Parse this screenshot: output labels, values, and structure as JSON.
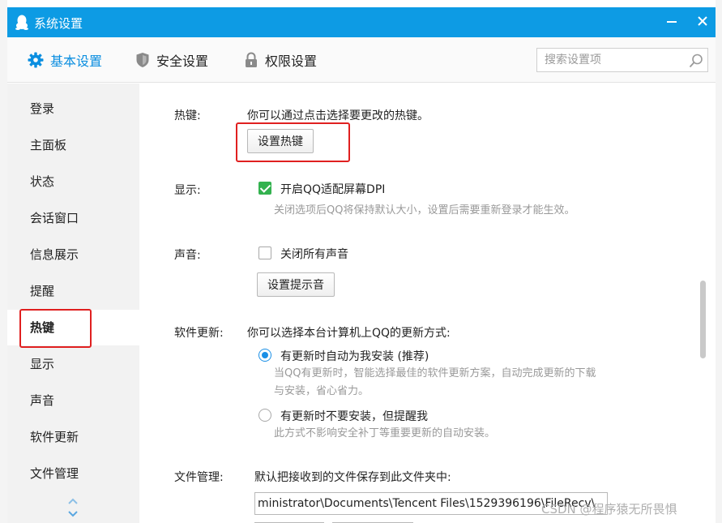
{
  "window": {
    "title": "系统设置"
  },
  "tabs": [
    {
      "label": "基本设置",
      "icon": "gear-icon",
      "active": true
    },
    {
      "label": "安全设置",
      "icon": "shield-icon",
      "active": false
    },
    {
      "label": "权限设置",
      "icon": "lock-icon",
      "active": false
    }
  ],
  "search": {
    "placeholder": "搜索设置项"
  },
  "sidebar": {
    "items": [
      {
        "label": "登录"
      },
      {
        "label": "主面板"
      },
      {
        "label": "状态"
      },
      {
        "label": "会话窗口"
      },
      {
        "label": "信息展示"
      },
      {
        "label": "提醒"
      },
      {
        "label": "热键",
        "active": true
      },
      {
        "label": "显示"
      },
      {
        "label": "声音"
      },
      {
        "label": "软件更新"
      },
      {
        "label": "文件管理"
      }
    ]
  },
  "hotkey": {
    "label": "热键:",
    "desc": "你可以通过点击选择要更改的热键。",
    "button": "设置热键"
  },
  "display": {
    "label": "显示:",
    "checkbox_label": "开启QQ适配屏幕DPI",
    "checked": true,
    "hint": "关闭选项后QQ将保持默认大小，设置后需要重新登录才能生效。"
  },
  "sound": {
    "label": "声音:",
    "checkbox_label": "关闭所有声音",
    "checked": false,
    "button": "设置提示音"
  },
  "update": {
    "label": "软件更新:",
    "desc": "你可以选择本台计算机上QQ的更新方式:",
    "options": [
      {
        "label": "有更新时自动为我安装 (推荐)",
        "checked": true,
        "hint_line1": "当QQ有更新时，智能选择最佳的软件更新方案，自动完成更新的下载",
        "hint_line2": "与安装，省心省力。"
      },
      {
        "label": "有更新时不要安装，但提醒我",
        "checked": false,
        "hint_line1": "此方式不影响安全补丁等重要更新的自动安装。"
      }
    ]
  },
  "files": {
    "label": "文件管理:",
    "desc": "默认把接收到的文件保存到此文件夹中:",
    "path": "ministrator\\Documents\\Tencent Files\\1529396196\\FileRecv\\"
  },
  "watermark": "CSDN @程序猿无所畏惧",
  "colors": {
    "titlebar": "#0d9be4",
    "accent": "#0a8ee0",
    "highlight": "#e02020",
    "check": "#33b24f"
  }
}
